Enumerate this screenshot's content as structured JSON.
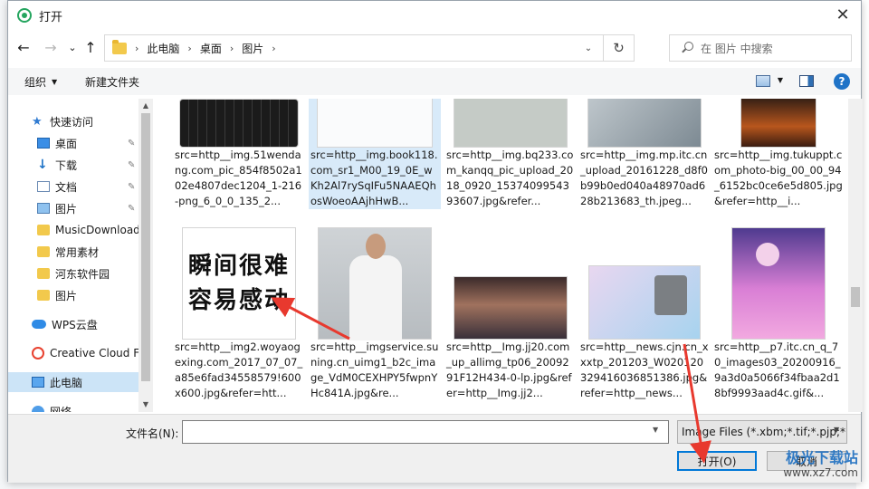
{
  "window": {
    "title": "打开",
    "close_label": "✕"
  },
  "nav": {
    "back": "←",
    "forward": "→",
    "recent": "⌄",
    "up": "↑",
    "breadcrumb": [
      "此电脑",
      "桌面",
      "图片"
    ],
    "sep": "›",
    "dropdown": "⌄",
    "refresh": "↻",
    "search_placeholder": "在 图片 中搜索"
  },
  "toolbar": {
    "organize": "组织",
    "caret": "▼",
    "new_folder": "新建文件夹",
    "help": "?"
  },
  "sidebar": {
    "items": [
      {
        "label": "快速访问",
        "icon": "star-icon",
        "pinned": false
      },
      {
        "label": "桌面",
        "icon": "desktop-icon",
        "pinned": true
      },
      {
        "label": "下载",
        "icon": "download-icon",
        "pinned": true
      },
      {
        "label": "文档",
        "icon": "document-icon",
        "pinned": true
      },
      {
        "label": "图片",
        "icon": "pictures-icon",
        "pinned": true
      },
      {
        "label": "MusicDownload",
        "icon": "folder-icon",
        "pinned": false
      },
      {
        "label": "常用素材",
        "icon": "folder-icon",
        "pinned": false
      },
      {
        "label": "河东软件园",
        "icon": "folder-icon",
        "pinned": false
      },
      {
        "label": "图片",
        "icon": "folder-icon",
        "pinned": false
      },
      {
        "label": "WPS云盘",
        "icon": "cloud-icon",
        "pinned": false
      },
      {
        "label": "Creative Cloud Fi",
        "icon": "creative-cloud-icon",
        "pinned": false
      },
      {
        "label": "此电脑",
        "icon": "computer-icon",
        "pinned": false,
        "selected": true
      },
      {
        "label": "网络",
        "icon": "network-icon",
        "pinned": false
      }
    ],
    "pin_glyph": "📌"
  },
  "files": {
    "row1": [
      {
        "name": "src=http__img.51wendang.com_pic_854f8502a102e4807dec1204_1-216-png_6_0_0_135_2...",
        "thumb": "keyboard"
      },
      {
        "name": "src=http__img.book118.com_sr1_M00_19_0E_wKh2Al7rySqIFu5NAAEQhosWoeoAAjhHwB...",
        "thumb": "document",
        "selected": true
      },
      {
        "name": "src=http__img.bq233.com_kanqq_pic_upload_2018_0920_1537409954393607.jpg&refer...",
        "thumb": "gray"
      },
      {
        "name": "src=http__img.mp.itc.cn_upload_20161228_d8f0b99b0ed040a48970ad628b213683_th.jpeg...",
        "thumb": "idcard-back"
      },
      {
        "name": "src=http__img.tukuppt.com_photo-big_00_00_94_6152bc0ce6e5d805.jpg&refer=http__i...",
        "thumb": "sunset"
      }
    ],
    "row2": [
      {
        "name": "src=http__img2.woyaogexing.com_2017_07_07_a85e6fad34558579!600x600.jpg&refer=htt...",
        "thumb": "calligraphy",
        "thumb_text": "瞬间很难\n容易感动"
      },
      {
        "name": "src=http__imgservice.suning.cn_uimg1_b2c_image_VdM0CEXHPY5fwpnYHc841A.jpg&re...",
        "thumb": "person"
      },
      {
        "name": "src=http__Img.jj20.com_up_allimg_tp06_2009291F12H434-0-lp.jpg&refer=http__Img.jj2...",
        "thumb": "landscape"
      },
      {
        "name": "src=http__news.cjn.cn_xxxtp_201203_W020120329416036851386.jpg&refer=http__news...",
        "thumb": "idcard-cat"
      },
      {
        "name": "src=http__p7.itc.cn_q_70_images03_20200916_9a3d0a5066f34fbaa2d18bf9993aad4c.gif&...",
        "thumb": "purple-moon"
      }
    ]
  },
  "bottom": {
    "filename_label": "文件名(N):",
    "filename_value": "",
    "filetype_value": "Image Files (*.xbm;*.tif;*.pjp;*",
    "open_label": "打开(O)",
    "cancel_label": "取消",
    "caret": "▼"
  },
  "watermark": {
    "title": "极光下载站",
    "url": "www.xz7.com"
  },
  "colors": {
    "accent": "#0078d7",
    "selection": "#cce4f7",
    "annotation": "#e8392e"
  }
}
